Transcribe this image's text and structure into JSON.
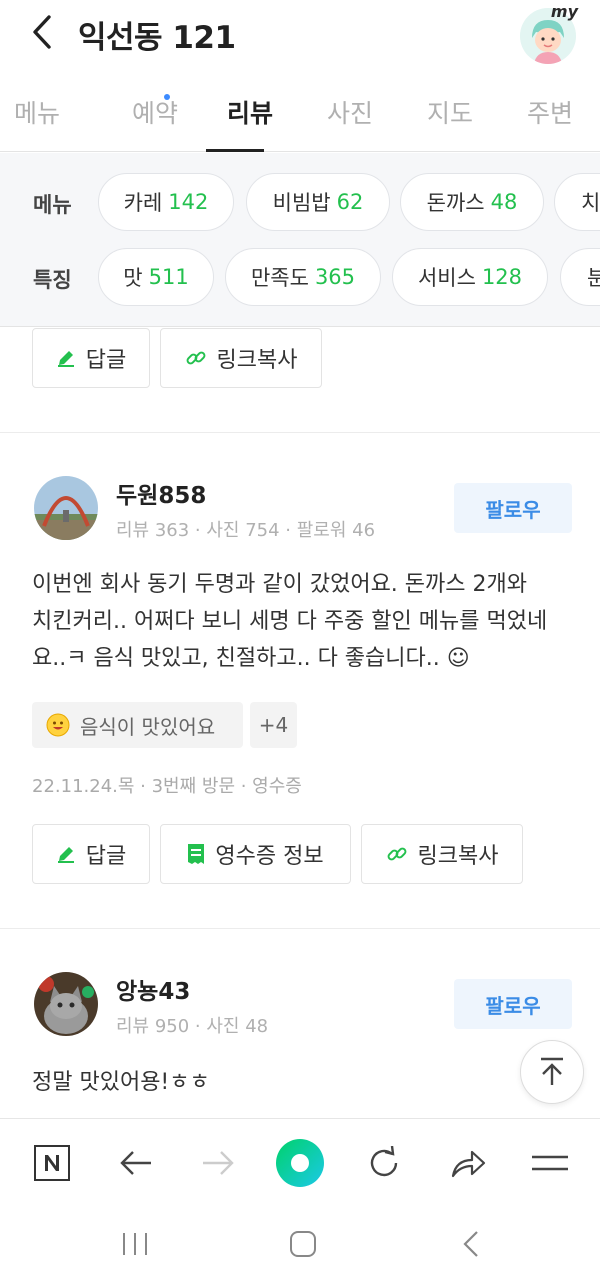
{
  "header": {
    "title": "익선동 121",
    "my_label": "my"
  },
  "tabs": [
    {
      "label": "메뉴",
      "active": false
    },
    {
      "label": "예약",
      "active": false,
      "dot": true
    },
    {
      "label": "리뷰",
      "active": true
    },
    {
      "label": "사진",
      "active": false
    },
    {
      "label": "지도",
      "active": false
    },
    {
      "label": "주변",
      "active": false
    }
  ],
  "filters": {
    "menu": {
      "label": "메뉴",
      "chips": [
        {
          "name": "카레",
          "count": "142"
        },
        {
          "name": "비빔밥",
          "count": "62"
        },
        {
          "name": "돈까스",
          "count": "48"
        },
        {
          "name": "치",
          "count": ""
        }
      ]
    },
    "feature": {
      "label": "특징",
      "chips": [
        {
          "name": "맛",
          "count": "511"
        },
        {
          "name": "만족도",
          "count": "365"
        },
        {
          "name": "서비스",
          "count": "128"
        },
        {
          "name": "분",
          "count": ""
        }
      ]
    }
  },
  "prev_review_actions": {
    "reply": "답글",
    "copy_link": "링크복사"
  },
  "reviews": [
    {
      "user": "두원858",
      "meta": "리뷰 363 · 사진 754 · 팔로워 46",
      "follow": "팔로우",
      "text_lines": [
        "이번엔 회사 동기 두명과 같이 갔었어요. 돈까스 2개와",
        "치킨커리.. 어쩌다 보니 세명 다 주중 할인 메뉴를 먹었네",
        "요..ㅋ 음식 맛있고, 친절하고.. 다 좋습니다.. ☺"
      ],
      "keyword": "음식이 맛있어요",
      "keyword_more": "+4",
      "visit": "22.11.24.목 · 3번째 방문 · 영수증",
      "actions": {
        "reply": "답글",
        "receipt": "영수증 정보",
        "copy_link": "링크복사"
      }
    },
    {
      "user": "앙뇽43",
      "meta": "리뷰 950 · 사진 48",
      "follow": "팔로우",
      "text": "정말 맛있어용!ㅎㅎ"
    }
  ],
  "colors": {
    "accent_green": "#23c04e",
    "follow_blue": "#3b8ce6",
    "tab_dot": "#3d8bff",
    "center_button": "#03c75a"
  },
  "icons": {
    "back": "chevron-left-icon",
    "reply": "pencil-icon",
    "receipt": "receipt-icon",
    "link": "link-icon",
    "scroll_top": "arrow-up-icon"
  }
}
